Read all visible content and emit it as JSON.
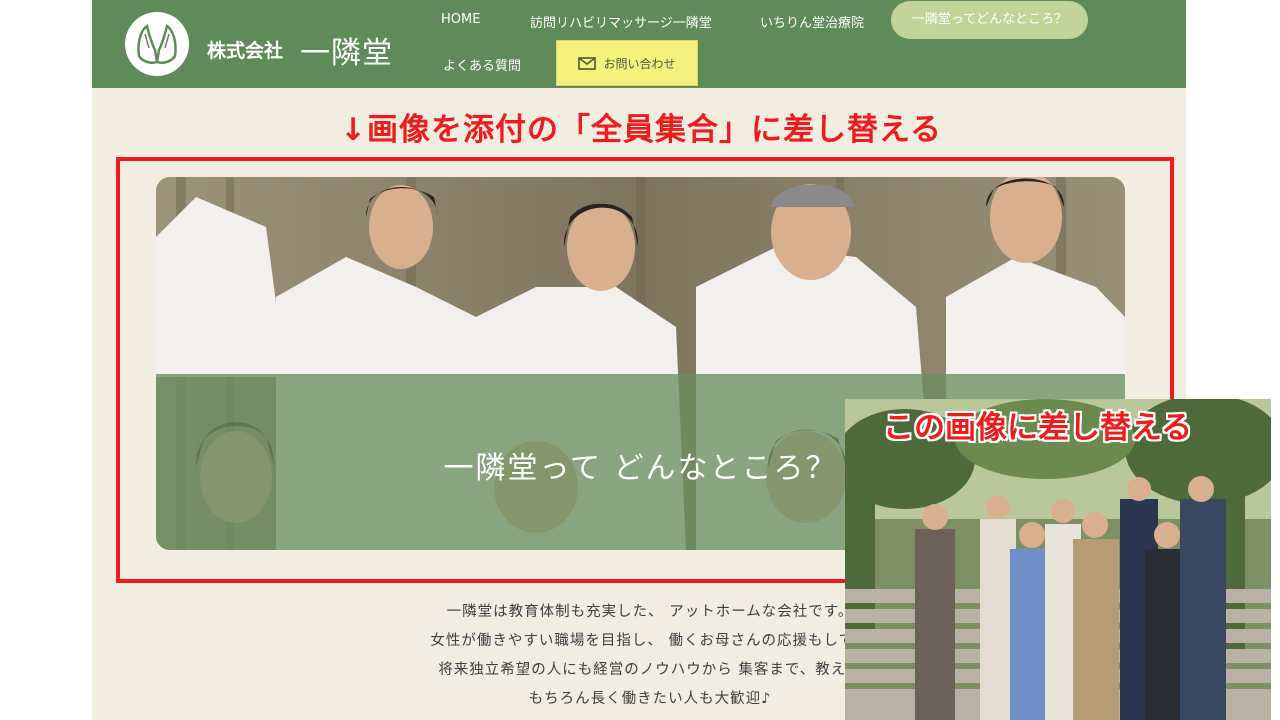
{
  "header": {
    "company_kind": "株式会社",
    "company_name": "一隣堂",
    "nav": [
      {
        "label": "HOME"
      },
      {
        "label": "訪問リハビリマッサージ一隣堂"
      },
      {
        "label": "いちりん堂治療院"
      },
      {
        "label": "一隣堂ってどんなところ？"
      },
      {
        "label": "よくある質問"
      }
    ],
    "contact_label": "お問い合わせ"
  },
  "annotations": {
    "top": "↓画像を添付の「全員集合」に差し替える",
    "inset": "この画像に差し替える"
  },
  "hero": {
    "title": "一隣堂って どんなところ？"
  },
  "body_lines": [
    "一隣堂は教育体制も充実した、 アットホームな会社です。",
    "女性が働きやすい職場を目指し、 働くお母さんの応援もしてい",
    "将来独立希望の人にも経営のノウハウから 集客まで、教えま",
    "もちろん長く働きたい人も大歓迎♪"
  ],
  "colors": {
    "header_green": "#5f8a5a",
    "page_bg": "#f1ede1",
    "annotation_red": "#ee1c1c",
    "contact_yellow": "#f4f27c",
    "active_pill": "#c3d49a"
  }
}
